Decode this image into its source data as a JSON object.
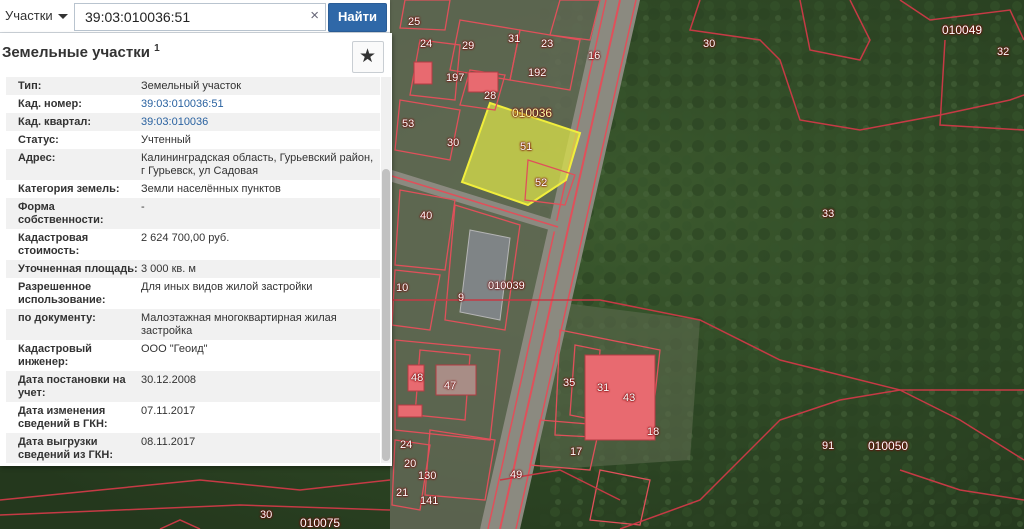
{
  "search": {
    "layer": "Участки",
    "query": "39:03:010036:51",
    "find_label": "Найти",
    "clear_symbol": "×"
  },
  "panel": {
    "title": "Земельные участки",
    "title_sup": "1",
    "star_symbol": "★",
    "rows": [
      {
        "label": "Тип:",
        "value": "Земельный участок"
      },
      {
        "label": "Кад. номер:",
        "value": "39:03:010036:51"
      },
      {
        "label": "Кад. квартал:",
        "value": "39:03:010036"
      },
      {
        "label": "Статус:",
        "value": "Учтенный"
      },
      {
        "label": "Адрес:",
        "value": "Калининградская область, Гурьевский район, г Гурьевск, ул Садовая"
      },
      {
        "label": "Категория земель:",
        "value": "Земли населённых пунктов"
      },
      {
        "label": "Форма собственности:",
        "value": "-"
      },
      {
        "label": "Кадастровая стоимость:",
        "value": "2 624 700,00 руб."
      },
      {
        "label": "Уточненная площадь:",
        "value": "3 000 кв. м"
      },
      {
        "label": "Разрешенное использование:",
        "value": "Для иных видов жилой застройки"
      },
      {
        "label": "по документу:",
        "value": "Малоэтажная многоквартирная жилая застройка"
      },
      {
        "label": "Кадастровый инженер:",
        "value": "ООО \"Геоид\""
      },
      {
        "label": "Дата постановки на учет:",
        "value": "30.12.2008"
      },
      {
        "label": "Дата изменения сведений в ГКН:",
        "value": "07.11.2017"
      },
      {
        "label": "Дата выгрузки сведений из ГКН:",
        "value": "08.11.2017"
      }
    ]
  },
  "map": {
    "colors": {
      "parcel_border": "#e0505a",
      "selected_fill": "#d9e04a",
      "building": "#e86a70"
    },
    "labels": [
      {
        "t": "30"
      },
      {
        "t": "010049"
      },
      {
        "t": "32"
      },
      {
        "t": "33"
      },
      {
        "t": "010036"
      },
      {
        "t": "51"
      },
      {
        "t": "52"
      },
      {
        "t": "192"
      },
      {
        "t": "23"
      },
      {
        "t": "16"
      },
      {
        "t": "31"
      },
      {
        "t": "29"
      },
      {
        "t": "28"
      },
      {
        "t": "30"
      },
      {
        "t": "53"
      },
      {
        "t": "197"
      },
      {
        "t": "24"
      },
      {
        "t": "25"
      },
      {
        "t": "40"
      },
      {
        "t": "9"
      },
      {
        "t": "10"
      },
      {
        "t": "010039"
      },
      {
        "t": "35"
      },
      {
        "t": "31"
      },
      {
        "t": "43"
      },
      {
        "t": "48"
      },
      {
        "t": "47"
      },
      {
        "t": "18"
      },
      {
        "t": "17"
      },
      {
        "t": "91"
      },
      {
        "t": "010050"
      },
      {
        "t": "49"
      },
      {
        "t": "130"
      },
      {
        "t": "21"
      },
      {
        "t": "141"
      },
      {
        "t": "30"
      },
      {
        "t": "010075"
      },
      {
        "t": "24"
      },
      {
        "t": "20"
      }
    ]
  }
}
